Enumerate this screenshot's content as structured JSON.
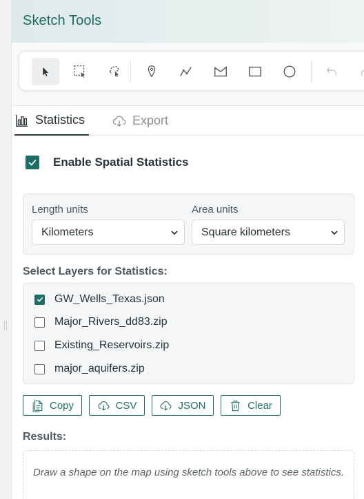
{
  "header": {
    "title": "Sketch Tools"
  },
  "toolbar": {
    "tools": [
      "select-pointer-icon",
      "rectangle-select-icon",
      "lasso-select-icon",
      "point-marker-icon",
      "polyline-icon",
      "polygon-icon",
      "rectangle-icon",
      "circle-icon",
      "undo-icon",
      "redo-icon"
    ],
    "active_tool": "select-pointer-icon"
  },
  "tabs": [
    {
      "label": "Statistics",
      "icon": "bar-chart-icon",
      "active": true
    },
    {
      "label": "Export",
      "icon": "cloud-download-icon",
      "active": false
    }
  ],
  "stats": {
    "enable_label": "Enable Spatial Statistics",
    "enabled": true,
    "length_units_label": "Length units",
    "length_units_value": "Kilometers",
    "area_units_label": "Area units",
    "area_units_value": "Square kilometers",
    "layers_title": "Select Layers for Statistics:",
    "layers": [
      {
        "name": "GW_Wells_Texas.json",
        "checked": true
      },
      {
        "name": "Major_Rivers_dd83.zip",
        "checked": false
      },
      {
        "name": "Existing_Reservoirs.zip",
        "checked": false
      },
      {
        "name": "major_aquifers.zip",
        "checked": false
      }
    ],
    "buttons": {
      "copy": "Copy",
      "csv": "CSV",
      "json": "JSON",
      "clear": "Clear"
    },
    "results_title": "Results:",
    "results_message": "Draw a shape on the map using sketch tools above to see statistics."
  },
  "colors": {
    "accent": "#1d6f66",
    "title": "#1c6b62",
    "text": "#2a3338"
  }
}
